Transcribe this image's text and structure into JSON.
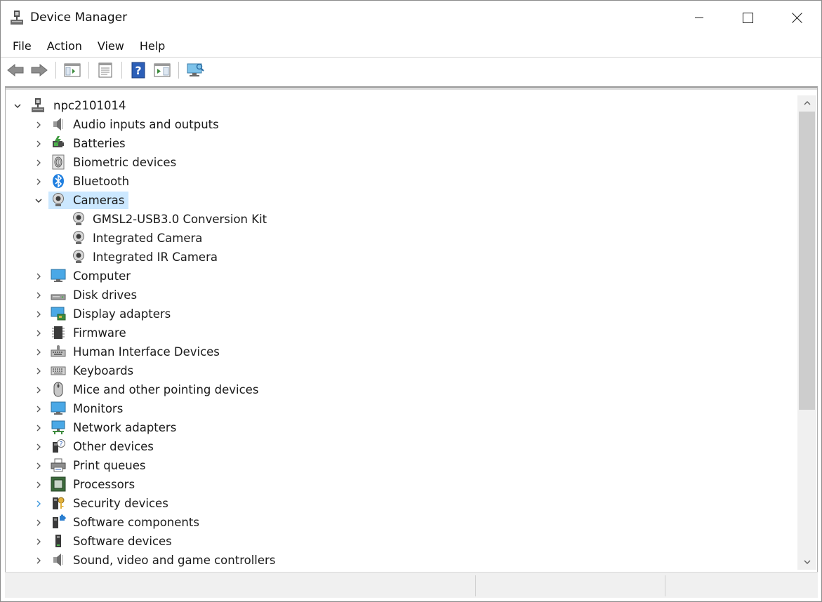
{
  "window": {
    "title": "Device Manager",
    "controls": {
      "minimize": "minimize",
      "maximize": "maximize",
      "close": "close"
    }
  },
  "menu": [
    "File",
    "Action",
    "View",
    "Help"
  ],
  "toolbar": {
    "buttons": [
      "back-arrow",
      "forward-arrow",
      "show-hide-console-tree",
      "properties",
      "help",
      "run",
      "scan-for-hardware-changes"
    ]
  },
  "tree": {
    "root": "npc2101014",
    "categories": [
      {
        "label": "Audio inputs and outputs",
        "icon": "speaker-icon",
        "expanded": false
      },
      {
        "label": "Batteries",
        "icon": "battery-icon",
        "expanded": false
      },
      {
        "label": "Biometric devices",
        "icon": "fingerprint-icon",
        "expanded": false
      },
      {
        "label": "Bluetooth",
        "icon": "bluetooth-icon",
        "expanded": false
      },
      {
        "label": "Cameras",
        "icon": "webcam-icon",
        "expanded": true,
        "selected": true,
        "children": [
          "GMSL2-USB3.0 Conversion Kit",
          "Integrated Camera",
          "Integrated IR Camera"
        ]
      },
      {
        "label": "Computer",
        "icon": "monitor-icon",
        "expanded": false
      },
      {
        "label": "Disk drives",
        "icon": "disk-drive-icon",
        "expanded": false
      },
      {
        "label": "Display adapters",
        "icon": "display-adapter-icon",
        "expanded": false
      },
      {
        "label": "Firmware",
        "icon": "chip-icon",
        "expanded": false
      },
      {
        "label": "Human Interface Devices",
        "icon": "hid-icon",
        "expanded": false
      },
      {
        "label": "Keyboards",
        "icon": "keyboard-icon",
        "expanded": false
      },
      {
        "label": "Mice and other pointing devices",
        "icon": "mouse-icon",
        "expanded": false
      },
      {
        "label": "Monitors",
        "icon": "monitor-icon",
        "expanded": false
      },
      {
        "label": "Network adapters",
        "icon": "network-icon",
        "expanded": false
      },
      {
        "label": "Other devices",
        "icon": "unknown-device-icon",
        "expanded": false
      },
      {
        "label": "Print queues",
        "icon": "printer-icon",
        "expanded": false
      },
      {
        "label": "Processors",
        "icon": "processor-icon",
        "expanded": false
      },
      {
        "label": "Security devices",
        "icon": "security-key-icon",
        "expanded": false,
        "hover": true
      },
      {
        "label": "Software components",
        "icon": "software-component-icon",
        "expanded": false
      },
      {
        "label": "Software devices",
        "icon": "software-device-icon",
        "expanded": false
      },
      {
        "label": "Sound, video and game controllers",
        "icon": "speaker-icon",
        "expanded": false
      }
    ]
  },
  "colors": {
    "selection": "#cce8ff",
    "accent": "#0078d7",
    "hover_chevron": "#3a96dd"
  }
}
